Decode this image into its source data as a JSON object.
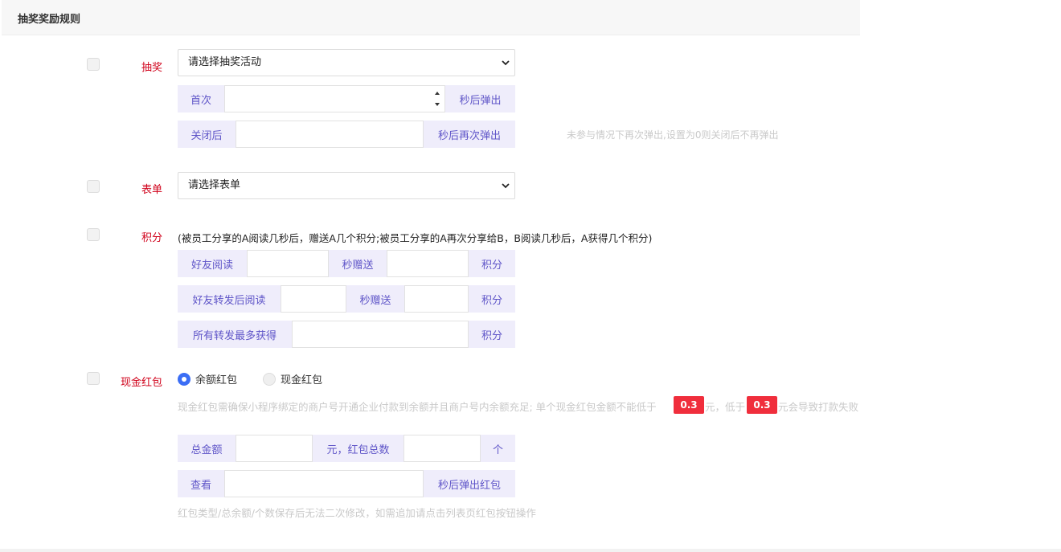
{
  "panel": {
    "title": "抽奖奖励规则"
  },
  "lottery": {
    "label": "抽奖",
    "select_value": "请选择抽奖活动",
    "first_prefix": "首次",
    "first_value": "",
    "first_suffix": "秒后弹出",
    "close_prefix": "关闭后",
    "close_value": "",
    "close_suffix": "秒后再次弹出",
    "hint": "未参与情况下再次弹出,设置为0则关闭后不再弹出"
  },
  "form": {
    "label": "表单",
    "select_value": "请选择表单"
  },
  "points": {
    "label": "积分",
    "description": "(被员工分享的A阅读几秒后，赠送A几个积分;被员工分享的A再次分享给B，B阅读几秒后，A获得几个积分)",
    "row1": {
      "prefix": "好友阅读",
      "mid": "秒赠送",
      "suffix": "积分"
    },
    "row2": {
      "prefix": "好友转发后阅读",
      "mid": "秒赠送",
      "suffix": "积分"
    },
    "row3": {
      "prefix": "所有转发最多获得",
      "suffix": "积分"
    }
  },
  "cash": {
    "label": "现金红包",
    "radio_balance": "余额红包",
    "radio_cash": "现金红包",
    "selected": "余额红包",
    "notice_part1": "现金红包需确保小程序绑定的商户号开通企业付款到余额并且商户号内余额充足; 单个现金红包金额不能低于",
    "min_amount_1": "0.3",
    "notice_part2": "元，低于",
    "min_amount_2": "0.3",
    "notice_part3": "元会导致打款失败",
    "total_prefix": "总金额",
    "total_mid": "元，红包总数",
    "total_suffix": "个",
    "view_prefix": "查看",
    "view_suffix": "秒后弹出红包",
    "footer_hint": "红包类型/总余额/个数保存后无法二次修改，如需追加请点击列表页红包按钮操作"
  },
  "colors": {
    "accent": "#3b6ef5",
    "label_red": "#d0021b",
    "addon_bg": "#efedfb",
    "addon_text": "#5f55c8",
    "badge": "#f02e3c"
  }
}
